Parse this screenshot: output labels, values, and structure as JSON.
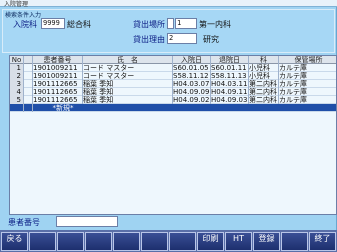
{
  "window": {
    "title": "入院管理"
  },
  "panel": {
    "title": "検索条件入力",
    "ward_label": "入院科",
    "ward_code": "9999",
    "ward_name": "総合科",
    "location_label": "貸出場所",
    "location_code": "1",
    "location_name": "第一内科",
    "reason_label": "貸出理由",
    "reason_code": "2",
    "reason_name": "研究"
  },
  "grid": {
    "columns": [
      "No",
      "",
      "患者番号",
      "氏　名",
      "入院日",
      "退院日",
      "科",
      "保管場所"
    ],
    "rows": [
      [
        "1",
        "",
        "1901009211",
        "コード マスター",
        "S60.01.05",
        "S60.01.11",
        "小児科",
        "カルテ庫"
      ],
      [
        "2",
        "",
        "1901009211",
        "コード マスター",
        "S58.11.12",
        "S58.11.13",
        "小児科",
        "カルテ庫"
      ],
      [
        "3",
        "",
        "1901112665",
        "稲葉 季知",
        "H04.03.07",
        "H04.03.11",
        "第二内科",
        "カルテ庫"
      ],
      [
        "4",
        "",
        "1901112665",
        "稲葉 季知",
        "H04.09.09",
        "H04.09.11",
        "第二内科",
        "カルテ庫"
      ],
      [
        "5",
        "",
        "1901112665",
        "稲葉 季知",
        "H04.09.02",
        "H04.09.03",
        "第二内科",
        "カルテ庫"
      ]
    ],
    "new_row_label": "*新規*"
  },
  "patient": {
    "label": "患者番号",
    "value": ""
  },
  "fkeys": [
    {
      "label": "戻る",
      "sub": ""
    },
    {
      "label": "",
      "sub": ""
    },
    {
      "label": "",
      "sub": ""
    },
    {
      "label": "",
      "sub": ""
    },
    {
      "label": "",
      "sub": ""
    },
    {
      "label": "",
      "sub": ""
    },
    {
      "label": "",
      "sub": ""
    },
    {
      "label": "印刷",
      "sub": ""
    },
    {
      "label": "HT",
      "sub": ""
    },
    {
      "label": "登録",
      "sub": ""
    },
    {
      "label": "",
      "sub": ""
    },
    {
      "label": "終了",
      "sub": ""
    }
  ]
}
